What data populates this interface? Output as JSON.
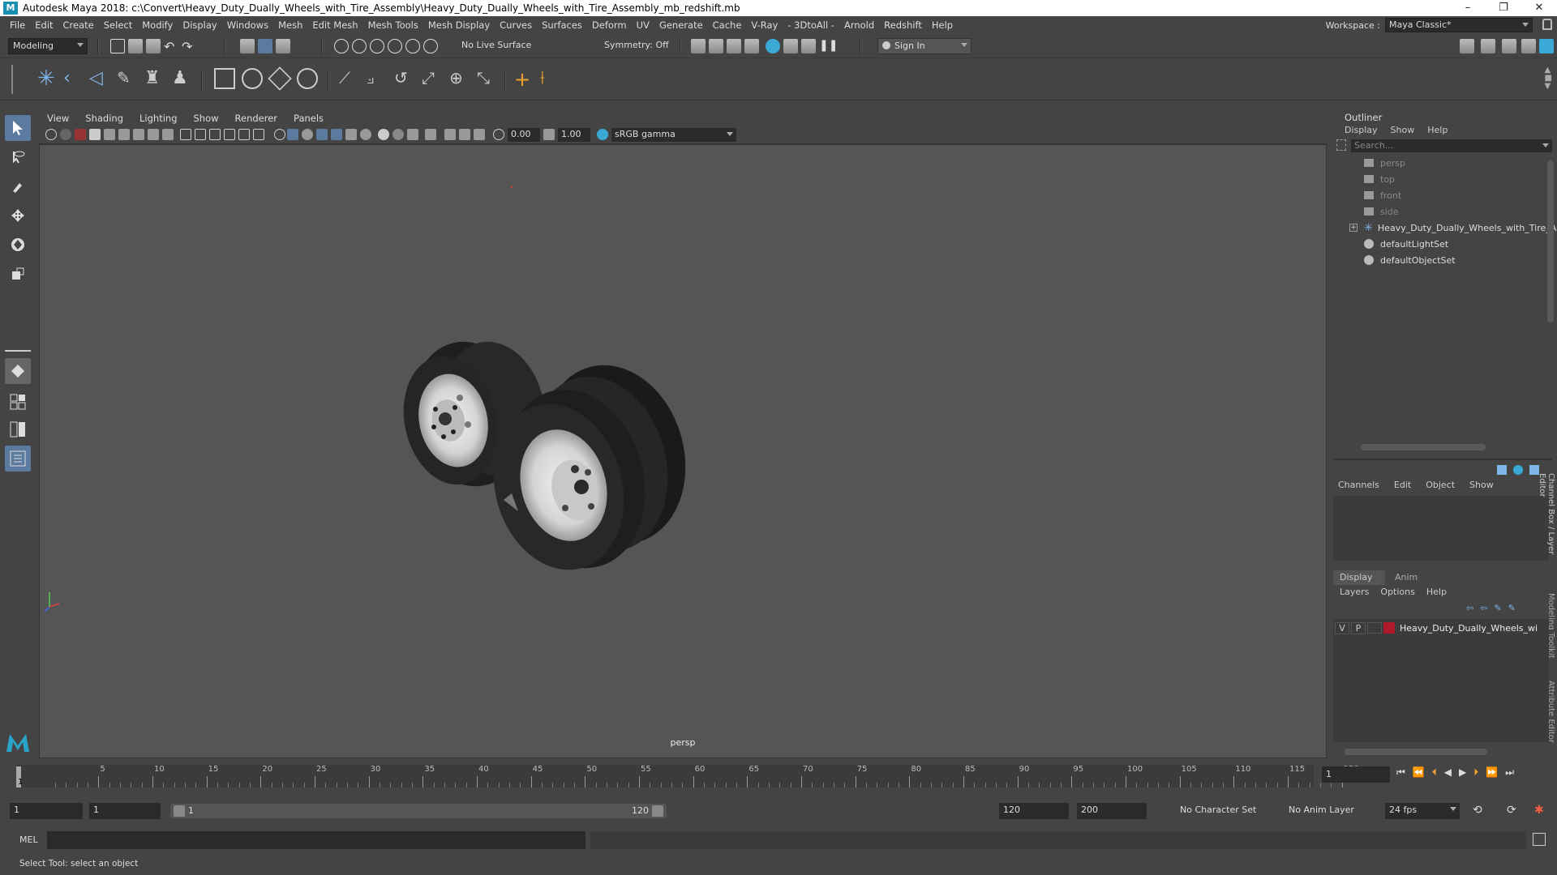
{
  "window": {
    "title": "Autodesk Maya 2018: c:\\Convert\\Heavy_Duty_Dually_Wheels_with_Tire_Assembly\\Heavy_Duty_Dually_Wheels_with_Tire_Assembly_mb_redshift.mb",
    "logo": "M",
    "controls": [
      "–",
      "❐",
      "✕"
    ]
  },
  "menubar": {
    "items": [
      "File",
      "Edit",
      "Create",
      "Select",
      "Modify",
      "Display",
      "Windows",
      "Mesh",
      "Edit Mesh",
      "Mesh Tools",
      "Mesh Display",
      "Curves",
      "Surfaces",
      "Deform",
      "UV",
      "Generate",
      "Cache",
      "V-Ray",
      "- 3DtoAll -",
      "Arnold",
      "Redshift",
      "Help"
    ],
    "workspace_label": "Workspace :",
    "workspace_value": "Maya Classic*"
  },
  "statusline": {
    "mode": "Modeling",
    "live_surface": "No Live Surface",
    "symmetry": "Symmetry: Off",
    "sign_in": "Sign In"
  },
  "viewport": {
    "menu": [
      "View",
      "Shading",
      "Lighting",
      "Show",
      "Renderer",
      "Panels"
    ],
    "exposure": "0.00",
    "gamma": "1.00",
    "color_space": "sRGB gamma",
    "camera_label": "persp"
  },
  "outliner": {
    "title": "Outliner",
    "menu": [
      "Display",
      "Show",
      "Help"
    ],
    "search_placeholder": "Search...",
    "items": [
      {
        "label": "persp",
        "type": "camera",
        "dim": true
      },
      {
        "label": "top",
        "type": "camera",
        "dim": true
      },
      {
        "label": "front",
        "type": "camera",
        "dim": true
      },
      {
        "label": "side",
        "type": "camera",
        "dim": true
      },
      {
        "label": "Heavy_Duty_Dually_Wheels_with_Tire_As",
        "type": "group",
        "dim": false
      },
      {
        "label": "defaultLightSet",
        "type": "set",
        "dim": false
      },
      {
        "label": "defaultObjectSet",
        "type": "set",
        "dim": false
      }
    ]
  },
  "channelbox": {
    "menu": [
      "Channels",
      "Edit",
      "Object",
      "Show"
    ],
    "side_tabs": [
      "Channel Box / Layer Editor",
      "Modeling Toolkit",
      "Attribute Editor"
    ]
  },
  "layers": {
    "tabs": [
      "Display",
      "Anim"
    ],
    "menu": [
      "Layers",
      "Options",
      "Help"
    ],
    "row": {
      "v": "V",
      "p": "P",
      "name": "Heavy_Duty_Dually_Wheels_wi",
      "color": "#b0182c"
    }
  },
  "timeline": {
    "ticks": [
      "5",
      "10",
      "15",
      "20",
      "25",
      "30",
      "35",
      "40",
      "45",
      "50",
      "55",
      "60",
      "65",
      "70",
      "75",
      "80",
      "85",
      "90",
      "95",
      "100",
      "105",
      "110",
      "115",
      "120"
    ],
    "current_marker": "1",
    "current_frame": "1"
  },
  "range": {
    "start": "1",
    "anim_start": "1",
    "slider_start": "1",
    "slider_end": "120",
    "end": "120",
    "anim_end": "200",
    "character_set": "No Character Set",
    "anim_layer": "No Anim Layer",
    "fps": "24 fps"
  },
  "cmdline": {
    "label": "MEL"
  },
  "helpline": {
    "text": "Select Tool: select an object"
  }
}
